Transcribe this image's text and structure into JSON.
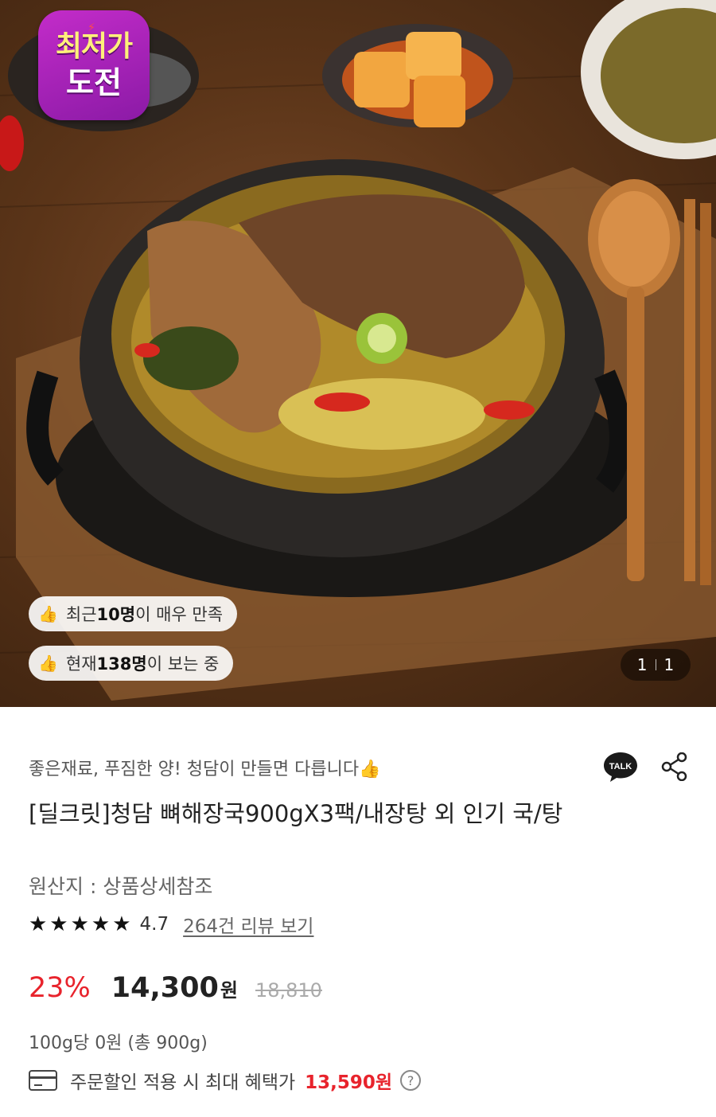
{
  "hero": {
    "badge_line1": "최저가",
    "badge_line2": "도전",
    "pill1": {
      "prefix": "최근 ",
      "count": "10명",
      "suffix": "이 매우 만족"
    },
    "pill2": {
      "prefix": "현재 ",
      "count": "138명",
      "suffix": "이 보는 중"
    },
    "image_counter": {
      "current": "1",
      "total": "1"
    }
  },
  "product": {
    "tagline": "좋은재료, 푸짐한 양! 청담이 만들면 다릅니다👍",
    "title": "[딜크릿]청담 뼈해장국900gX3팩/내장탕 외 인기 국/탕",
    "origin": "원산지 : 상품상세참조",
    "rating": "4.7",
    "stars": "★★★★★",
    "review_link": "264건 리뷰 보기",
    "talk_label": "TALK"
  },
  "price": {
    "discount": "23%",
    "sale": "14,300",
    "currency": "원",
    "original": "18,810",
    "unit_price": "100g당 0원 (총 900g)",
    "benefit_text": "주문할인 적용 시 최대 혜택가",
    "benefit_price": "13,590원",
    "help": "?"
  },
  "colors": {
    "accent_red": "#e8232c",
    "badge_purple": "#a726b8",
    "kakao": "#1a1a1a"
  }
}
